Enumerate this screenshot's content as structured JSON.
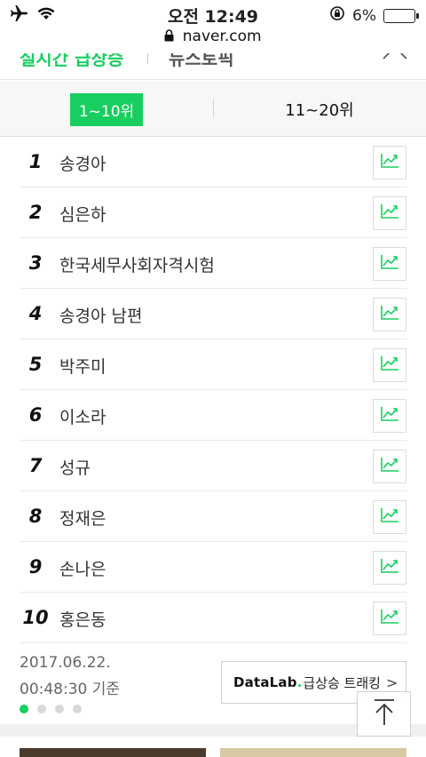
{
  "status_bar": {
    "time": "오전 12:49",
    "url": "naver.com",
    "battery": "6%",
    "battery_level": 0.06
  },
  "section_header": {
    "title_active": "실시간 급상승",
    "title_other": "뉴스토픽"
  },
  "tabs": [
    {
      "label": "1~10위",
      "active": true
    },
    {
      "label": "11~20위",
      "active": false
    }
  ],
  "ranks": [
    {
      "rank": "1",
      "keyword": "송경아"
    },
    {
      "rank": "2",
      "keyword": "심은하"
    },
    {
      "rank": "3",
      "keyword": "한국세무사회자격시험"
    },
    {
      "rank": "4",
      "keyword": "송경아 남편"
    },
    {
      "rank": "5",
      "keyword": "박주미"
    },
    {
      "rank": "6",
      "keyword": "이소라"
    },
    {
      "rank": "7",
      "keyword": "성규"
    },
    {
      "rank": "8",
      "keyword": "정재은"
    },
    {
      "rank": "9",
      "keyword": "손나은"
    },
    {
      "rank": "10",
      "keyword": "홍은동"
    }
  ],
  "footer": {
    "date": "2017.06.22.",
    "time": "00:48:30 기준",
    "datalab_brand": "DataLab",
    "datalab_dot": ".",
    "datalab_text": "급상승 트래킹",
    "datalab_chevron": ">"
  },
  "colors": {
    "accent": "#19ce60"
  }
}
